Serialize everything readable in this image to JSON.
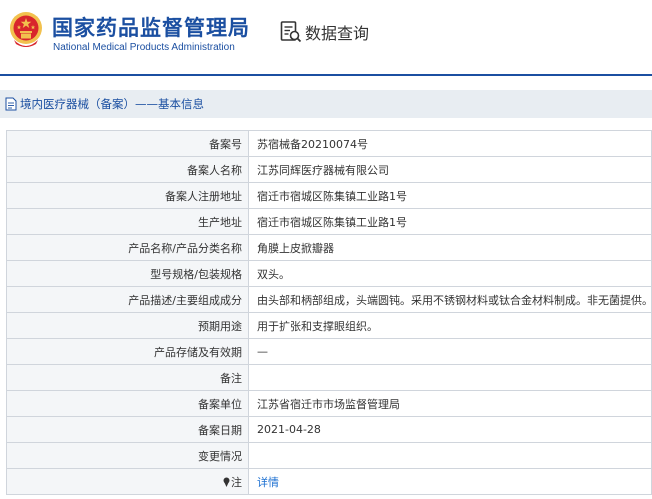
{
  "header": {
    "title_cn": "国家药品监督管理局",
    "title_en": "National Medical Products Administration",
    "query_label": "数据查询",
    "accent_color": "#1b4fa1"
  },
  "breadcrumb": {
    "text": "境内医疗器械（备案）——基本信息"
  },
  "record": {
    "rows": [
      {
        "label": "备案号",
        "value": "苏宿械备20210074号"
      },
      {
        "label": "备案人名称",
        "value": "江苏同辉医疗器械有限公司"
      },
      {
        "label": "备案人注册地址",
        "value": "宿迁市宿城区陈集镇工业路1号"
      },
      {
        "label": "生产地址",
        "value": "宿迁市宿城区陈集镇工业路1号"
      },
      {
        "label": "产品名称/产品分类名称",
        "value": "角膜上皮掀瓣器"
      },
      {
        "label": "型号规格/包装规格",
        "value": "双头。"
      },
      {
        "label": "产品描述/主要组成成分",
        "value": "由头部和柄部组成，头端圆钝。采用不锈钢材料或钛合金材料制成。非无菌提供。"
      },
      {
        "label": "预期用途",
        "value": "用于扩张和支撑眼组织。"
      },
      {
        "label": "产品存储及有效期",
        "value": "—"
      },
      {
        "label": "备注",
        "value": ""
      },
      {
        "label": "备案单位",
        "value": "江苏省宿迁市市场监督管理局"
      },
      {
        "label": "备案日期",
        "value": "2021-04-28"
      },
      {
        "label": "变更情况",
        "value": ""
      }
    ],
    "note_label": "注",
    "detail_link": "详情"
  }
}
